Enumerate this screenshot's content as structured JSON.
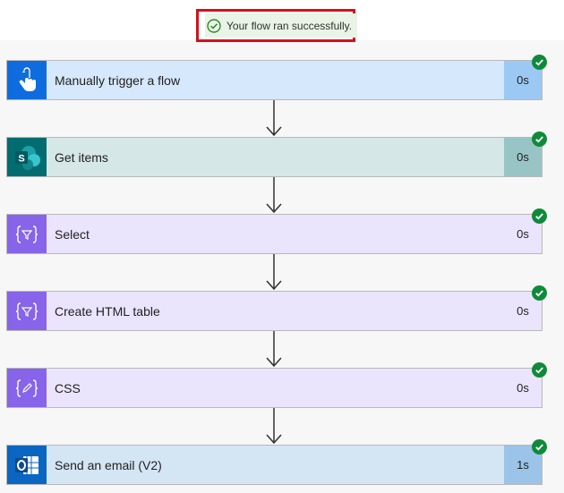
{
  "banner": {
    "text": "Your flow ran successfully.",
    "icon": "check-circle-icon"
  },
  "colors": {
    "success_green": "#0f7b0f",
    "banner_border": "#d0121b"
  },
  "steps": [
    {
      "label": "Manually trigger a flow",
      "duration": "0s",
      "icon": "touch-hand-icon",
      "icon_bg": "#0f6cde",
      "body_bg": "#d6e8fb",
      "duration_bg": "#9cc9f4"
    },
    {
      "label": "Get items",
      "duration": "0s",
      "icon": "sharepoint-icon",
      "icon_bg": "#036c70",
      "body_bg": "#d5e7e7",
      "duration_bg": "#99c4c6"
    },
    {
      "label": "Select",
      "duration": "0s",
      "icon": "data-operation-icon",
      "icon_bg": "#8764ea",
      "body_bg": "#ebe4fd",
      "duration_bg": "#ebe4fd"
    },
    {
      "label": "Create HTML table",
      "duration": "0s",
      "icon": "data-operation-icon",
      "icon_bg": "#8764ea",
      "body_bg": "#ebe4fd",
      "duration_bg": "#ebe4fd"
    },
    {
      "label": "CSS",
      "duration": "0s",
      "icon": "compose-icon",
      "icon_bg": "#8764ea",
      "body_bg": "#ebe4fd",
      "duration_bg": "#ebe4fd"
    },
    {
      "label": "Send an email (V2)",
      "duration": "1s",
      "icon": "outlook-icon",
      "icon_bg": "#0a66c2",
      "body_bg": "#d4e5f4",
      "duration_bg": "#9cc4e8"
    }
  ]
}
